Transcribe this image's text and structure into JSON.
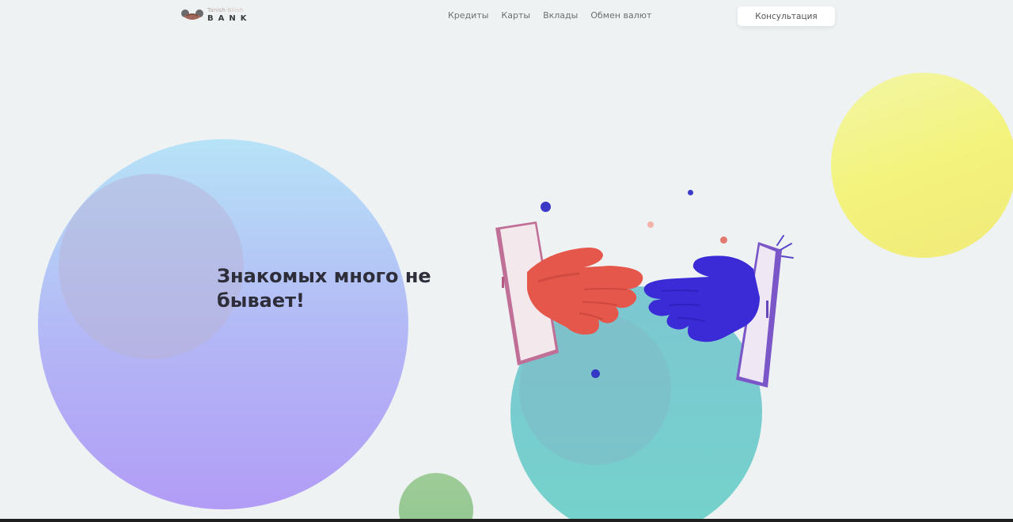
{
  "header": {
    "logo": {
      "top_text_part1": "Tanish",
      "top_text_part2": "-Bilish",
      "bottom_text": "BANK",
      "icon": "handshake-icon"
    },
    "nav": [
      {
        "label": "Кредиты"
      },
      {
        "label": "Карты"
      },
      {
        "label": "Вклады"
      },
      {
        "label": "Обмен валют"
      }
    ],
    "cta_label": "Консультация"
  },
  "hero": {
    "headline": "Знакомых много не бывает!",
    "illustration": "phones-handshake-illustration"
  },
  "colors": {
    "background": "#eef2f3",
    "big_circle": "#b3b6f6",
    "yellow_circle": "#f3f37d",
    "teal_circle": "#74d2cb",
    "green_circle": "#9fcc98",
    "left_hand": "#e5584a",
    "right_hand": "#3a2bd6",
    "headline": "#2e2e3a"
  }
}
